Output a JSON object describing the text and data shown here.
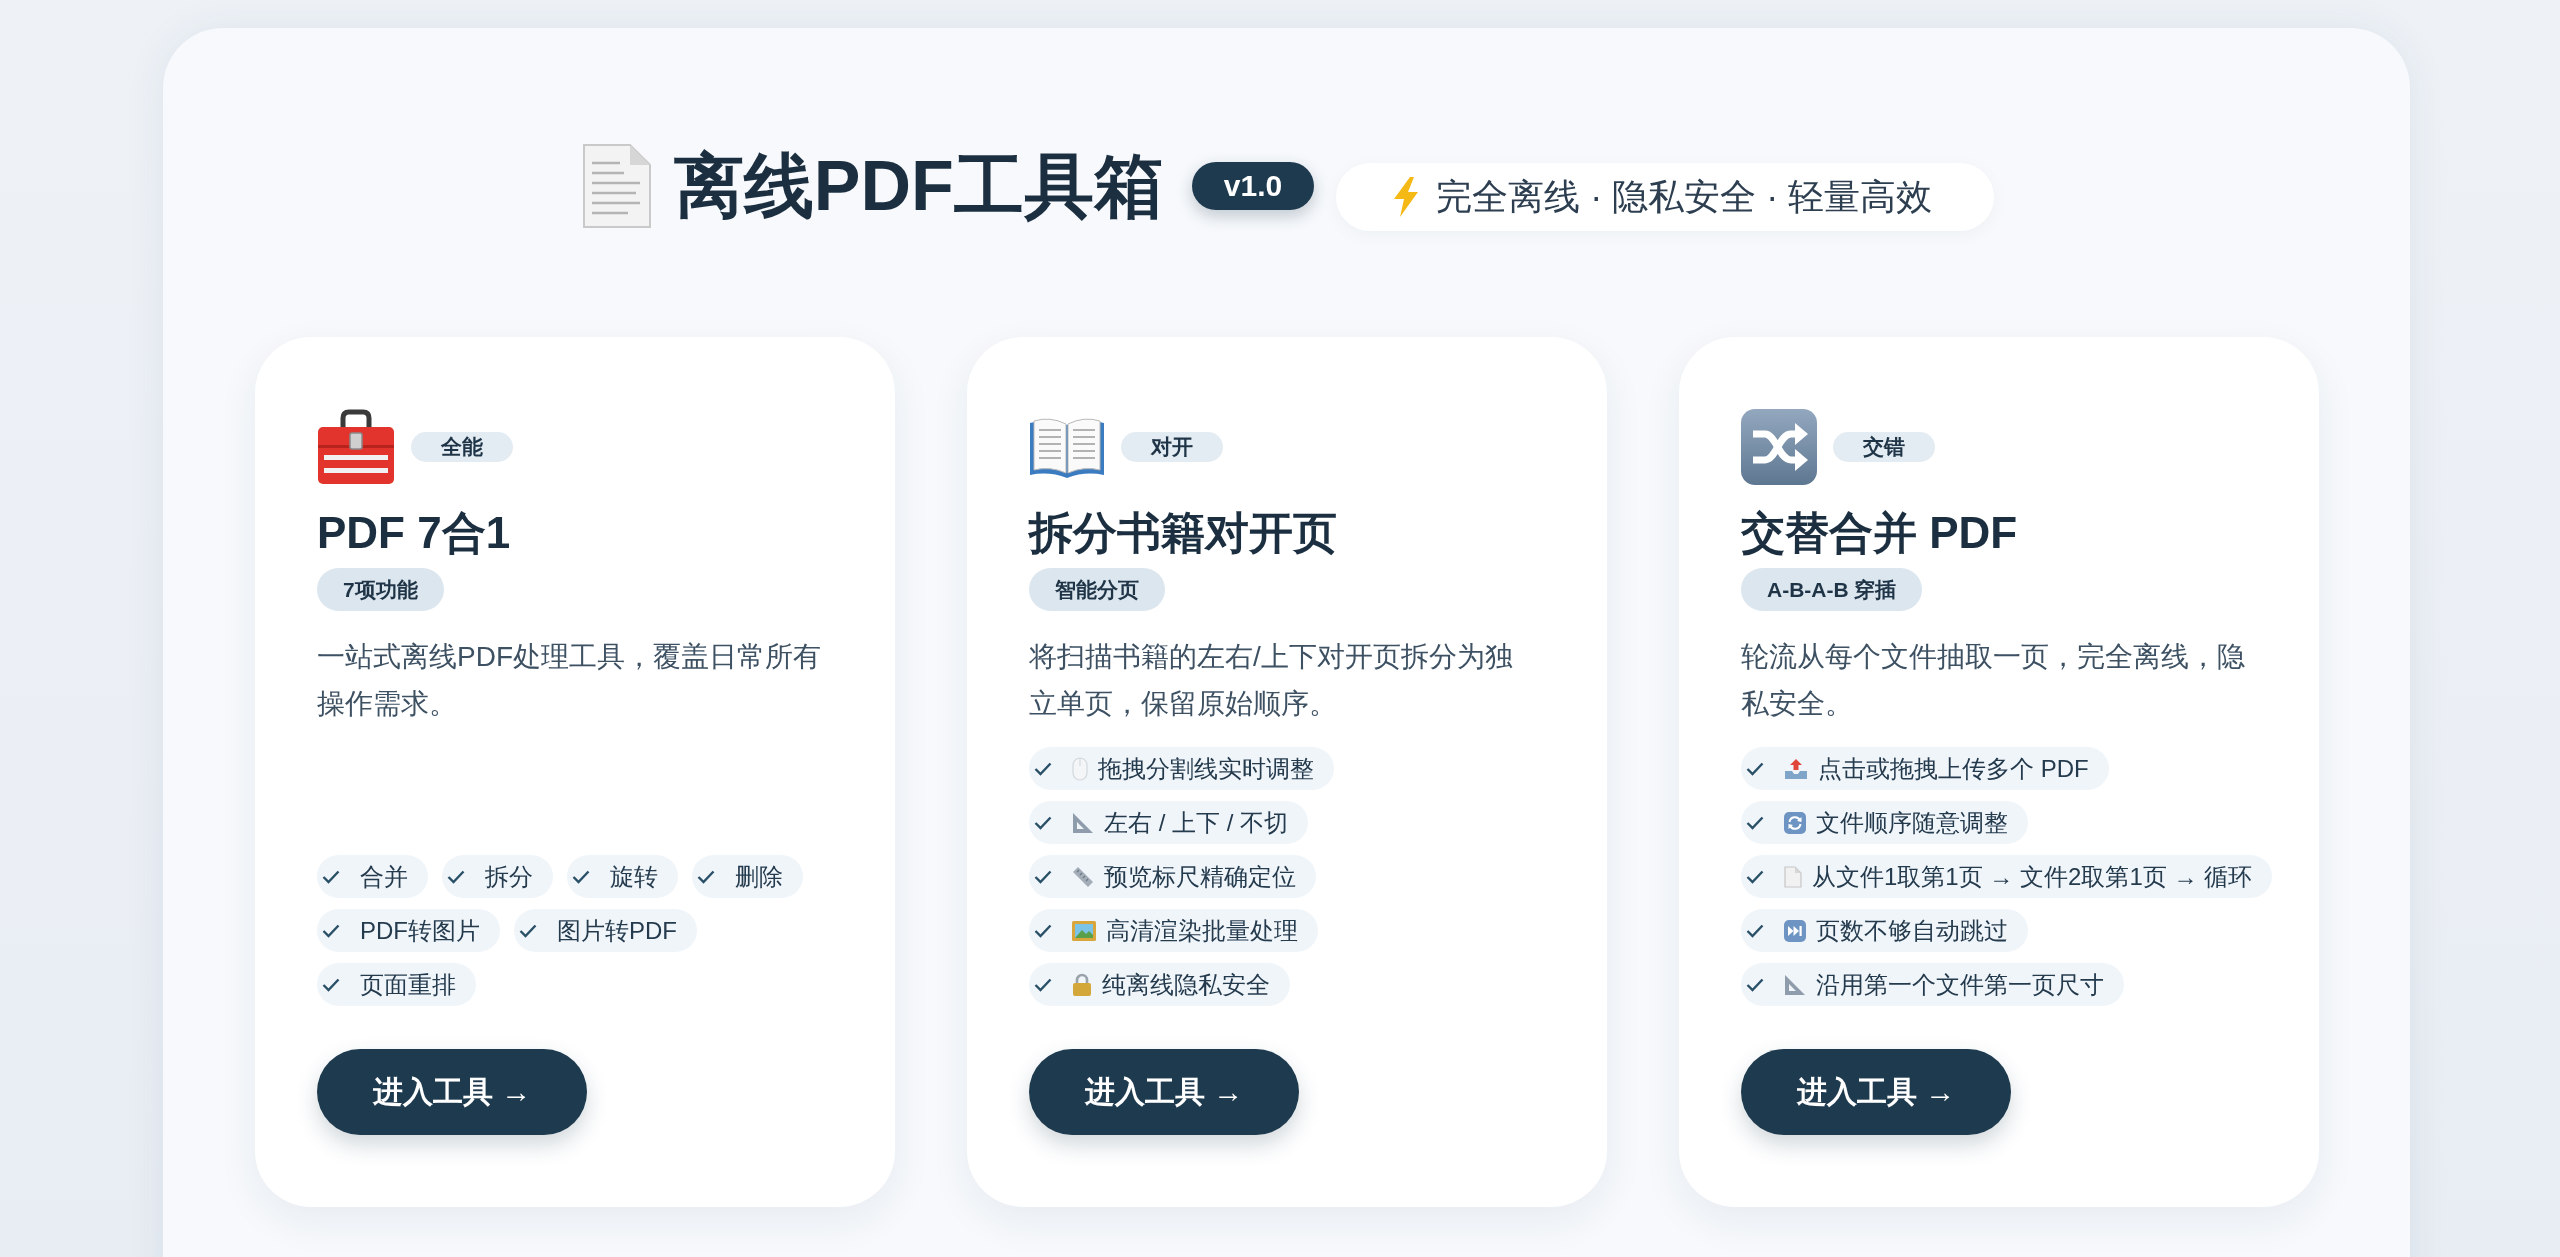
{
  "header": {
    "title": "离线PDF工具箱",
    "version": "v1.0",
    "tagline": "完全离线 · 隐私安全 · 轻量高效"
  },
  "cards": [
    {
      "tag": "全能",
      "title": "PDF 7合1",
      "subtag": "7项功能",
      "description": "一站式离线PDF处理工具，覆盖日常所有操作需求。",
      "features": [
        "合并",
        "拆分",
        "旋转",
        "删除",
        "PDF转图片",
        "图片转PDF",
        "页面重排"
      ],
      "button": "进入工具 →"
    },
    {
      "tag": "对开",
      "title": "拆分书籍对开页",
      "subtag": "智能分页",
      "description": "将扫描书籍的左右/上下对开页拆分为独立单页，保留原始顺序。",
      "features": [
        "拖拽分割线实时调整",
        "左右 / 上下 / 不切",
        "预览标尺精确定位",
        "高清渲染批量处理",
        "纯离线隐私安全"
      ],
      "button": "进入工具 →"
    },
    {
      "tag": "交错",
      "title": "交替合并 PDF",
      "subtag": "A-B-A-B 穿插",
      "description": "轮流从每个文件抽取一页，完全离线，隐私安全。",
      "features": [
        "点击或拖拽上传多个 PDF",
        "文件顺序随意调整",
        "从文件1取第1页 → 文件2取第1页 → 循环",
        "页数不够自动跳过",
        "沿用第一个文件第一页尺寸"
      ],
      "button": "进入工具 →"
    }
  ]
}
